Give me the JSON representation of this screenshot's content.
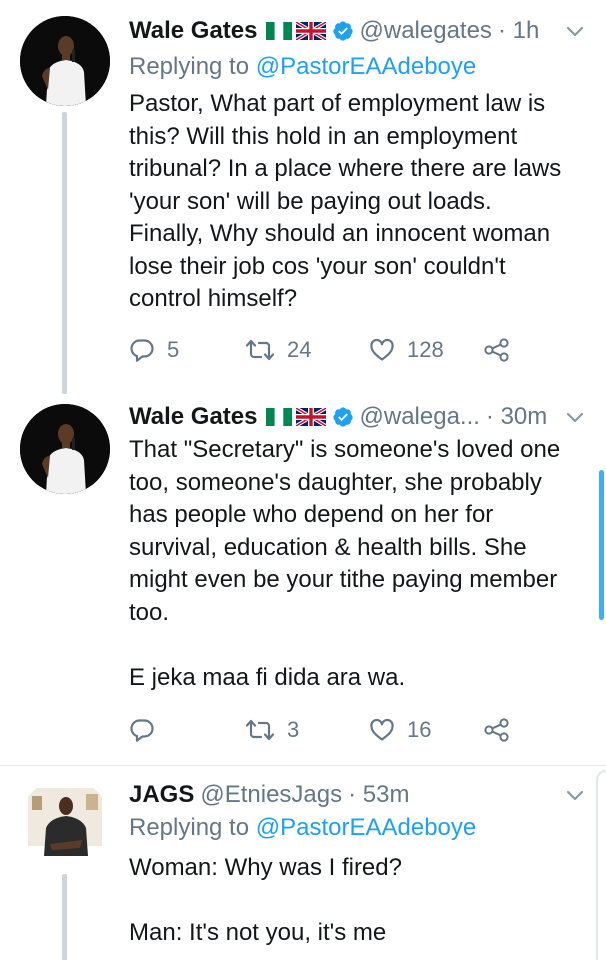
{
  "tweets": [
    {
      "name": "Wale Gates",
      "handle": "@walegates",
      "time": "· 1h",
      "replying_prefix": "Replying to ",
      "replying_to": "@PastorEAAdeboye",
      "text": "Pastor, What part of employment law is\nthis? Will this hold in an employment\ntribunal? In a place where there are laws\n'your son' will be paying out loads.\nFinally, Why should an innocent woman\nlose their job cos 'your son' couldn't\ncontrol himself?",
      "replies": "5",
      "retweets": "24",
      "likes": "128"
    },
    {
      "name": "Wale Gates",
      "handle": "@walega...",
      "time": "· 30m",
      "text": "That \"Secretary\" is someone's loved one\ntoo, someone's daughter, she probably\nhas people who depend on her for\nsurvival, education & health bills. She\nmight even be your tithe paying member\ntoo.\n\nE jeka maa fi dida ara wa.",
      "replies": "",
      "retweets": "3",
      "likes": "16"
    },
    {
      "name": "JAGS",
      "handle": "@EtniesJags",
      "time": "· 53m",
      "replying_prefix": "Replying to ",
      "replying_to": "@PastorEAAdeboye",
      "text": "Woman: Why was I fired?\n\nMan: It's not you, it's me"
    }
  ],
  "icons": {
    "verified": "verified-badge-icon",
    "chevron": "chevron-down-icon",
    "reply": "reply-icon",
    "retweet": "retweet-icon",
    "like": "heart-icon",
    "share": "share-icon",
    "flag_ng": "nigeria-flag-icon",
    "flag_uk": "uk-flag-icon"
  },
  "colors": {
    "link": "#1da1f2",
    "muted": "#657786",
    "text": "#14171a",
    "verified": "#1da1f2"
  }
}
